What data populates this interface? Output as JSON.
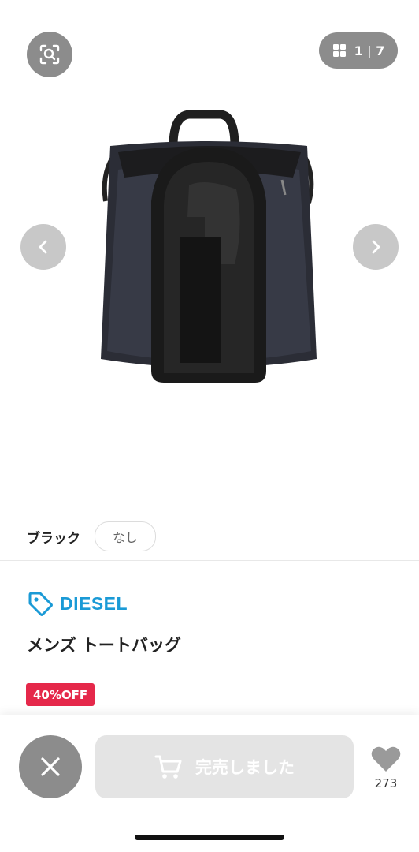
{
  "gallery": {
    "counter_current": "1",
    "counter_separator": "|",
    "counter_total": "7",
    "lens_icon": "image-search-icon",
    "grid_icon": "grid-icon",
    "prev_icon": "chevron-left-icon",
    "next_icon": "chevron-right-icon",
    "image_alt": "DIESEL メンズ トートバッグ"
  },
  "variant": {
    "color_label": "ブラック",
    "size_option": "なし"
  },
  "product": {
    "brand": "DIESEL",
    "brand_icon": "tag-icon",
    "brand_color": "#1a9ad6",
    "title": "メンズ トートバッグ",
    "discount": "40%OFF",
    "discount_color": "#e5284a"
  },
  "actions": {
    "close_icon": "close-icon",
    "soldout_label": "完売しました",
    "cart_icon": "cart-icon",
    "like_icon": "heart-icon",
    "like_count": "273"
  }
}
